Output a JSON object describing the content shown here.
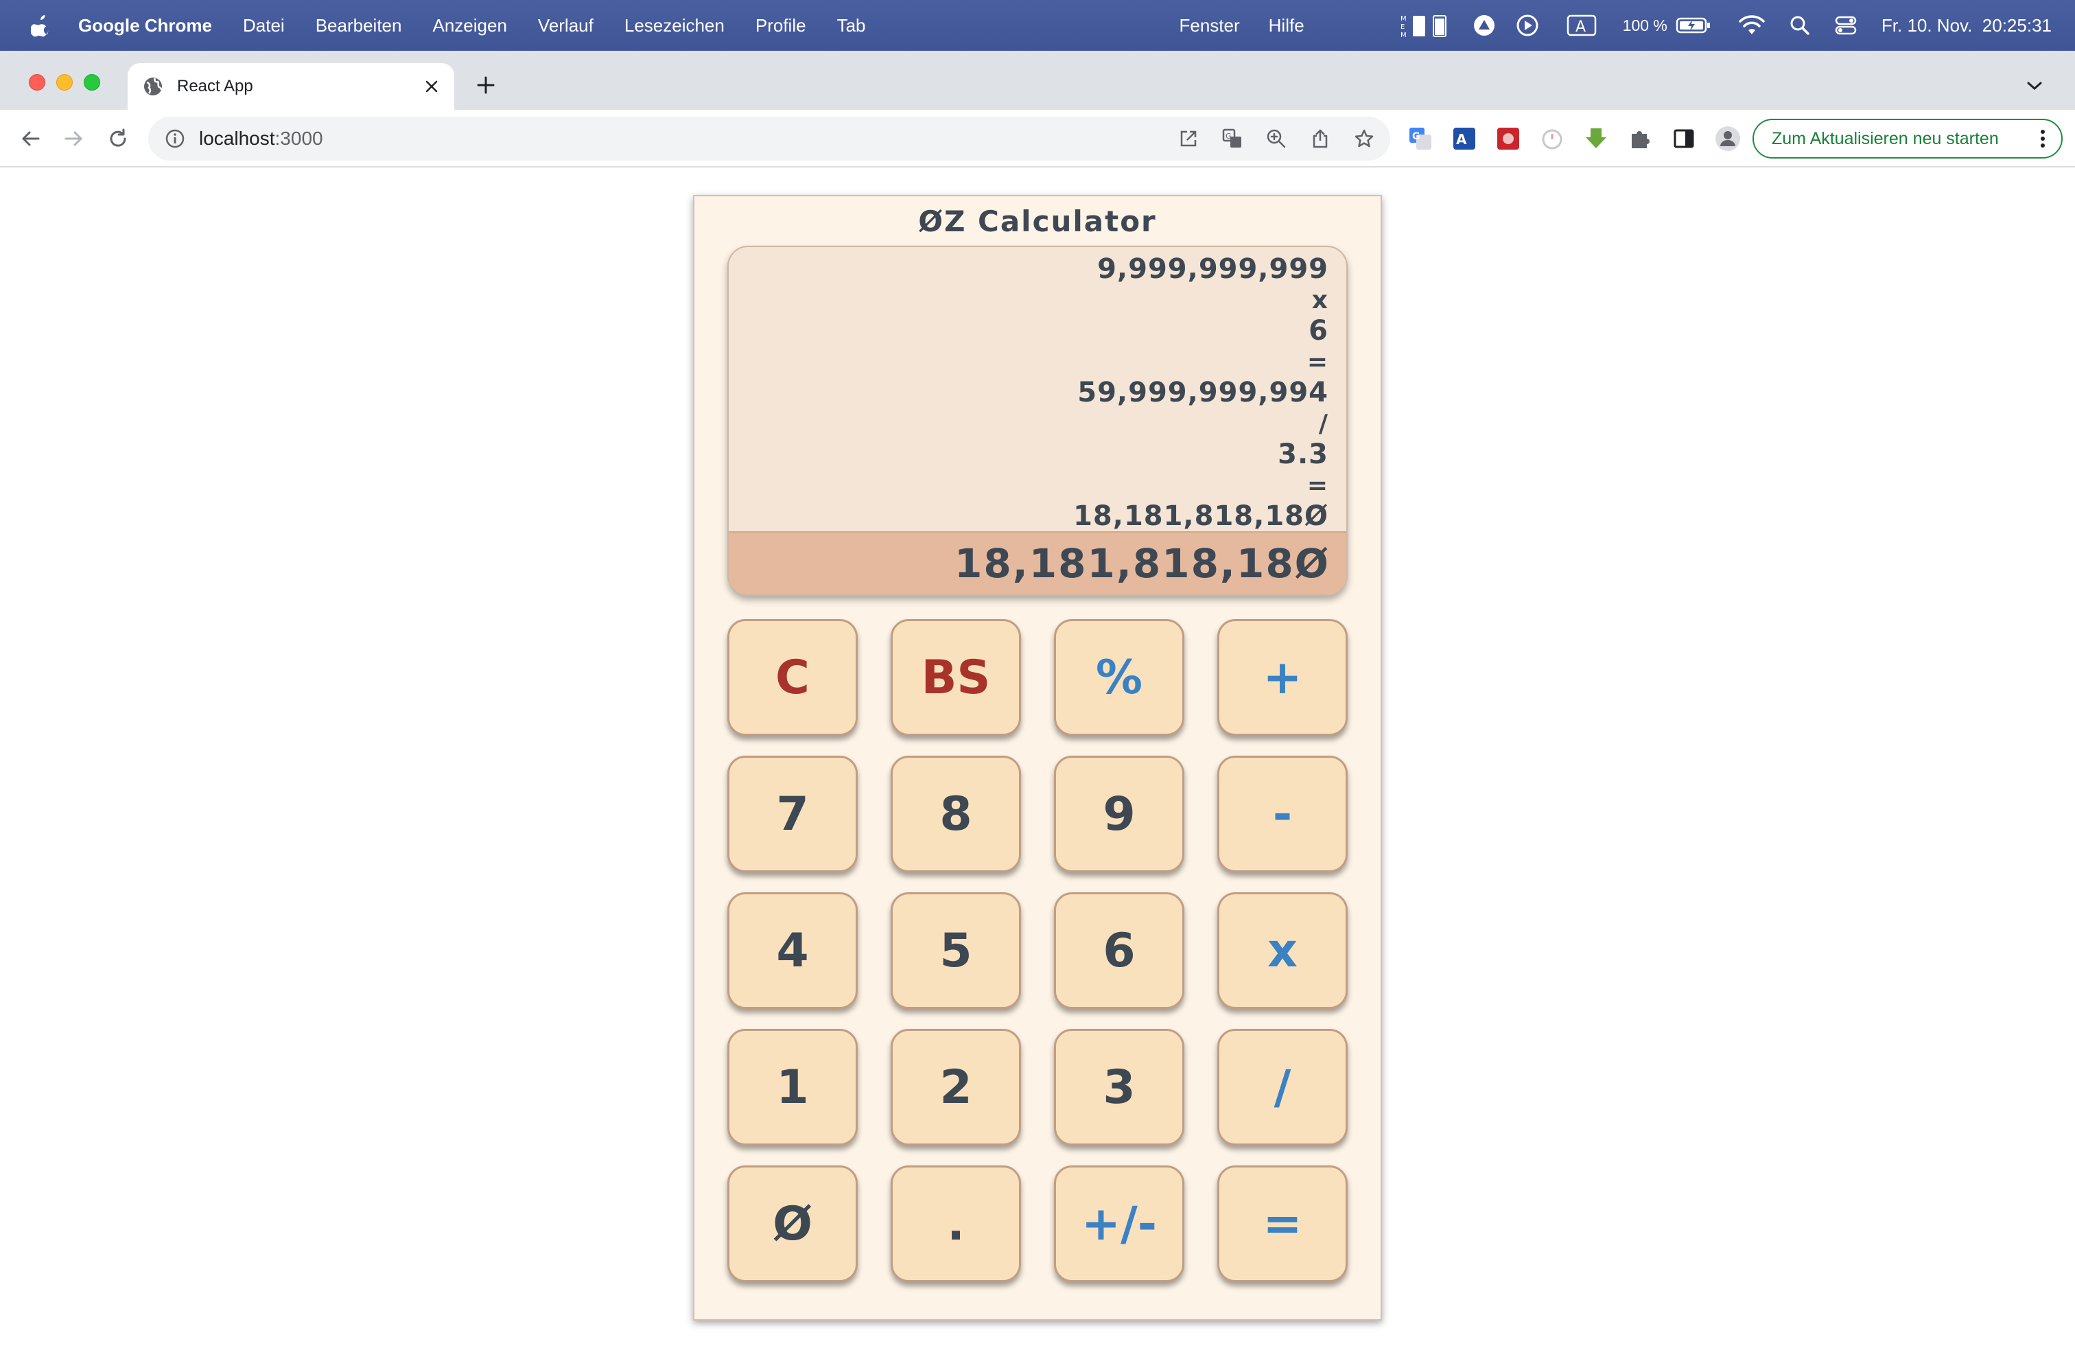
{
  "menubar": {
    "app_name": "Google Chrome",
    "items": [
      "Datei",
      "Bearbeiten",
      "Anzeigen",
      "Verlauf",
      "Lesezeichen",
      "Profile",
      "Tab"
    ],
    "right_items": [
      "Fenster",
      "Hilfe"
    ],
    "battery": "100 %",
    "datetime": "Fr. 10. Nov.  20:25:31"
  },
  "browser": {
    "tab_title": "React App",
    "url_host": "localhost",
    "url_port": ":3000",
    "relaunch_label": "Zum Aktualisieren neu starten"
  },
  "calculator": {
    "title": "ØZ Calculator",
    "history": [
      "9,999,999,999",
      "x",
      "6",
      "=",
      "59,999,999,994",
      "/",
      "3.3",
      "=",
      "18,181,818,18Ø"
    ],
    "result": "18,181,818,18Ø",
    "keys": {
      "clear": "C",
      "backspace": "BS",
      "percent": "%",
      "add": "+",
      "seven": "7",
      "eight": "8",
      "nine": "9",
      "subtract": "-",
      "four": "4",
      "five": "5",
      "six": "6",
      "multiply": "x",
      "one": "1",
      "two": "2",
      "three": "3",
      "divide": "/",
      "zero": "Ø",
      "decimal": ".",
      "negate": "+/-",
      "equals": "="
    }
  },
  "colors": {
    "menubar": "#4a5f9f",
    "calc_background": "#fdf3e6",
    "display": "#f4e5d6",
    "result_bar": "#e4b99e",
    "key": "#f9e1bd",
    "digit_text": "#3e4853",
    "red_text": "#a8332b",
    "operator_text": "#3a82c4"
  }
}
